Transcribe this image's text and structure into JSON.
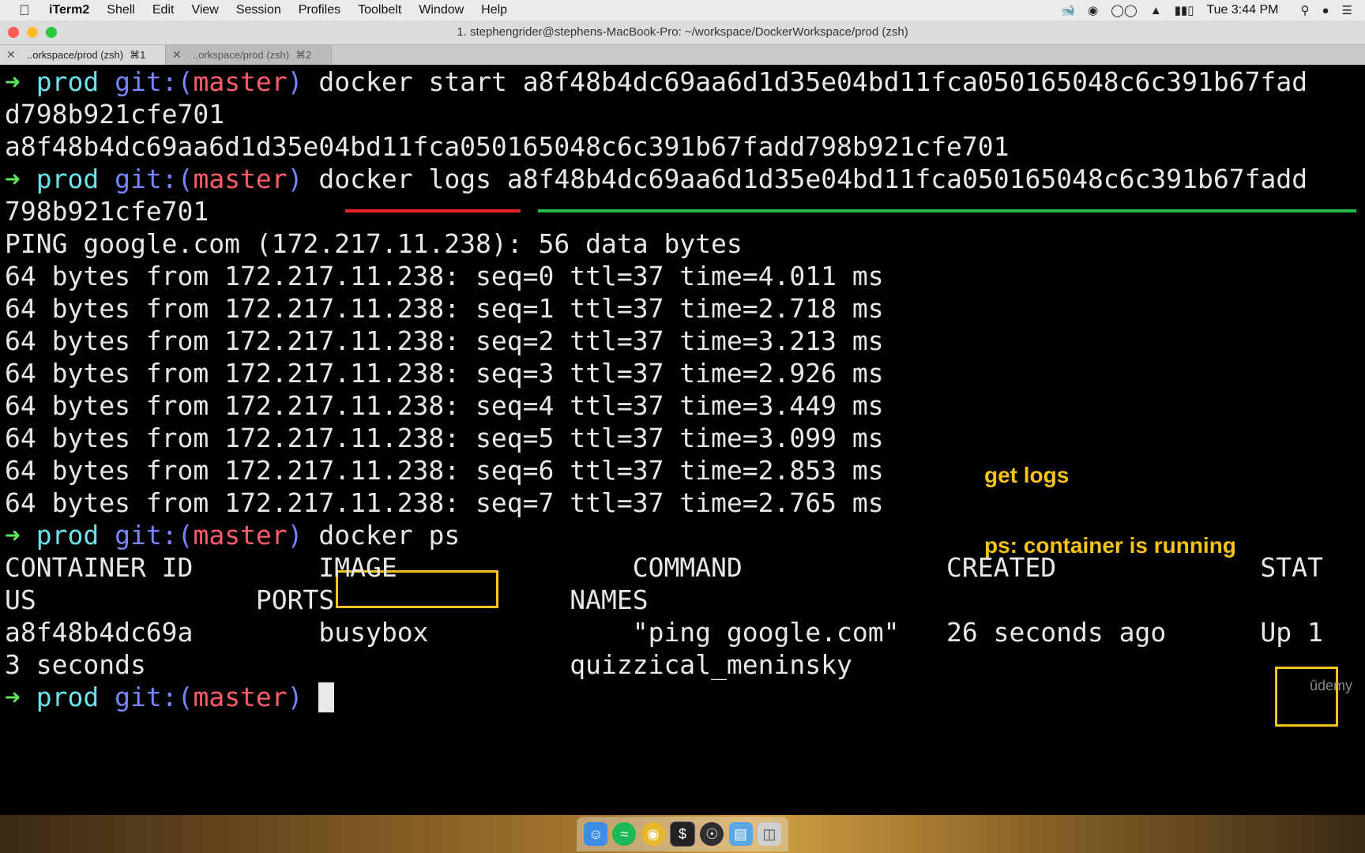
{
  "menubar": {
    "apple_icon": "apple-logo-icon",
    "app_name": "iTerm2",
    "items": [
      "Shell",
      "Edit",
      "View",
      "Session",
      "Profiles",
      "Toolbelt",
      "Window",
      "Help"
    ],
    "status_icons": [
      "docker-icon",
      "creative-cloud-icon",
      "glasses-icon",
      "wifi-icon",
      "battery-icon"
    ],
    "clock": "Tue 3:44 PM",
    "right_icons": [
      "spotlight-search-icon",
      "siri-icon",
      "notification-center-icon"
    ]
  },
  "window": {
    "title": "1. stephengrider@stephens-MacBook-Pro: ~/workspace/DockerWorkspace/prod (zsh)"
  },
  "tabs": [
    {
      "title": "..orkspace/prod (zsh)",
      "shortcut": "⌘1",
      "active": true
    },
    {
      "title": "..orkspace/prod (zsh)",
      "shortcut": "⌘2",
      "active": false
    }
  ],
  "prompt": {
    "arrow": "➜",
    "dir": "prod",
    "git_open": "git:(",
    "branch": "master",
    "git_close": ")"
  },
  "terminal": {
    "cmd1": "docker start a8f48b4dc69aa6d1d35e04bd11fca050165048c6c391b67fad",
    "cmd1_wrap": "d798b921cfe701",
    "cmd1_output": "a8f48b4dc69aa6d1d35e04bd11fca050165048c6c391b67fadd798b921cfe701",
    "cmd2_cmd": "docker logs",
    "cmd2_arg": "a8f48b4dc69aa6d1d35e04bd11fca050165048c6c391b67fadd",
    "cmd2_wrap": "798b921cfe701",
    "ping_lines": [
      "PING google.com (172.217.11.238): 56 data bytes",
      "64 bytes from 172.217.11.238: seq=0 ttl=37 time=4.011 ms",
      "64 bytes from 172.217.11.238: seq=1 ttl=37 time=2.718 ms",
      "64 bytes from 172.217.11.238: seq=2 ttl=37 time=3.213 ms",
      "64 bytes from 172.217.11.238: seq=3 ttl=37 time=2.926 ms",
      "64 bytes from 172.217.11.238: seq=4 ttl=37 time=3.449 ms",
      "64 bytes from 172.217.11.238: seq=5 ttl=37 time=3.099 ms",
      "64 bytes from 172.217.11.238: seq=6 ttl=37 time=2.853 ms",
      "64 bytes from 172.217.11.238: seq=7 ttl=37 time=2.765 ms"
    ],
    "cmd3": "docker ps",
    "ps_header_1": "CONTAINER ID        IMAGE               COMMAND             CREATED             STAT",
    "ps_header_2": "US              PORTS               NAMES",
    "ps_row_1_pre": "a8f48b4dc69a        busybox             \"ping google.com\"   26 seconds ago      ",
    "ps_row_1_status": "Up",
    "ps_row_1_post": " 1",
    "ps_row_2": "3 seconds                           quizzical_meninsky"
  },
  "annotations": {
    "get_logs": "get logs",
    "ps_running": "ps: container is running"
  },
  "watermark": "ûdemy",
  "dock_icons": [
    "finder-icon",
    "spotify-icon",
    "chrome-icon",
    "terminal-icon",
    "obs-icon",
    "folder-icon",
    "trash-icon"
  ],
  "colors": {
    "prompt_arrow": "#5ce65c",
    "prompt_dir": "#6fe3ec",
    "prompt_git": "#7a86ff",
    "prompt_branch": "#ff5c6c",
    "annotation": "#f5c31a",
    "underline_logs": "#e8232c",
    "underline_id": "#22b84a"
  }
}
